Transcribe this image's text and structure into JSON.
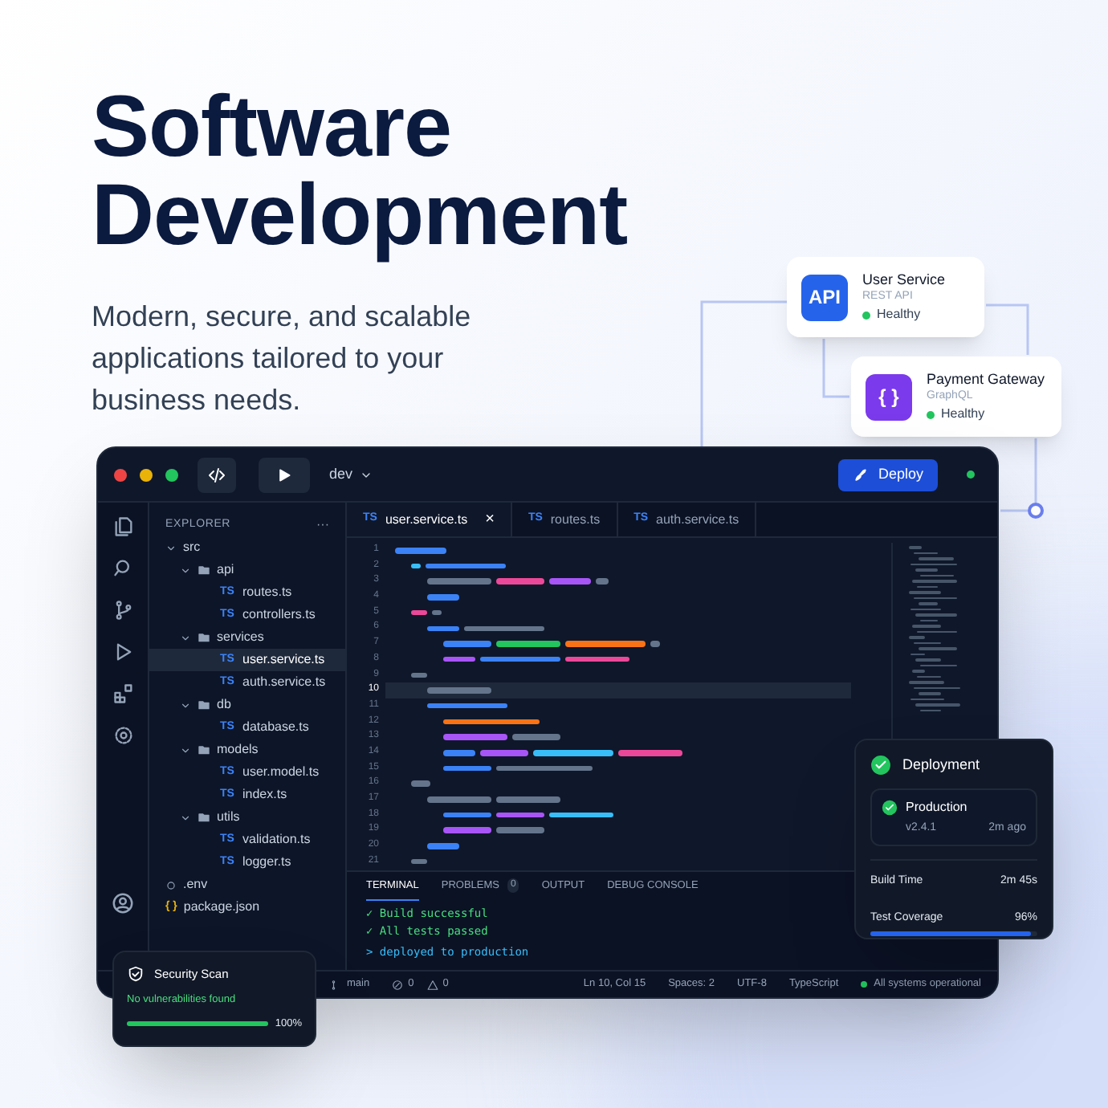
{
  "hero": {
    "title": "Software Development",
    "subtitle": "Modern, secure, and scalable applications tailored to your business needs."
  },
  "services": [
    {
      "icon_text": "API",
      "color": "#2563eb",
      "name": "User Service",
      "type": "REST API",
      "status": "Healthy"
    },
    {
      "icon_text": "{ }",
      "color": "#7c3aed",
      "name": "Payment Gateway",
      "type": "GraphQL",
      "status": "Healthy"
    }
  ],
  "editor": {
    "toolbar": {
      "branch": "dev",
      "deploy_label": "Deploy"
    },
    "explorer": {
      "title": "EXPLORER",
      "menu": "···",
      "tree": [
        {
          "kind": "folder",
          "name": "src",
          "expanded": true,
          "selected": false,
          "children": [
            {
              "kind": "folder",
              "name": "api",
              "expanded": true,
              "selected": false,
              "children": [
                {
                  "kind": "ts",
                  "badge": "TS",
                  "name": "routes.ts",
                  "selected": false
                },
                {
                  "kind": "ts",
                  "badge": "TS",
                  "name": "controllers.ts",
                  "selected": false
                }
              ]
            },
            {
              "kind": "folder",
              "name": "services",
              "expanded": true,
              "selected": false,
              "children": [
                {
                  "kind": "ts",
                  "badge": "TS",
                  "name": "user.service.ts",
                  "selected": true
                },
                {
                  "kind": "ts",
                  "badge": "TS",
                  "name": "auth.service.ts",
                  "selected": false
                }
              ]
            },
            {
              "kind": "folder",
              "name": "db",
              "expanded": true,
              "selected": false,
              "children": [
                {
                  "kind": "ts",
                  "badge": "TS",
                  "name": "database.ts",
                  "selected": false
                }
              ]
            },
            {
              "kind": "folder",
              "name": "models",
              "expanded": true,
              "selected": false,
              "children": [
                {
                  "kind": "ts",
                  "badge": "TS",
                  "name": "user.model.ts",
                  "selected": false
                },
                {
                  "kind": "ts",
                  "badge": "TS",
                  "name": "index.ts",
                  "selected": false
                }
              ]
            },
            {
              "kind": "folder",
              "name": "utils",
              "expanded": true,
              "selected": false,
              "children": [
                {
                  "kind": "ts",
                  "badge": "TS",
                  "name": "validation.ts",
                  "selected": false
                },
                {
                  "kind": "ts",
                  "badge": "TS",
                  "name": "logger.ts",
                  "selected": false
                }
              ]
            }
          ]
        },
        {
          "kind": "env",
          "name": ".env",
          "selected": false
        },
        {
          "kind": "json",
          "badge": "{ }",
          "name": "package.json",
          "selected": false
        }
      ]
    },
    "tabs": [
      {
        "badge": "TS",
        "label": "user.service.ts",
        "selected": true,
        "close": "×"
      },
      {
        "badge": "TS",
        "label": "routes.ts",
        "selected": false
      },
      {
        "badge": "TS",
        "label": "auth.service.ts",
        "selected": false
      }
    ],
    "line_numbers": [
      {
        "number": "1",
        "selected": false
      },
      {
        "number": "2",
        "selected": false
      },
      {
        "number": "3",
        "selected": false
      },
      {
        "number": "4",
        "selected": false
      },
      {
        "number": "5",
        "selected": false
      },
      {
        "number": "6",
        "selected": false
      },
      {
        "number": "7",
        "selected": false
      },
      {
        "number": "8",
        "selected": false
      },
      {
        "number": "9",
        "selected": false
      },
      {
        "number": "10",
        "selected": true
      },
      {
        "number": "11",
        "selected": false
      },
      {
        "number": "12",
        "selected": false
      },
      {
        "number": "13",
        "selected": false
      },
      {
        "number": "14",
        "selected": false
      },
      {
        "number": "15",
        "selected": false
      },
      {
        "number": "16",
        "selected": false
      },
      {
        "number": "17",
        "selected": false
      },
      {
        "number": "18",
        "selected": false
      },
      {
        "number": "19",
        "selected": false
      },
      {
        "number": "20",
        "selected": false
      },
      {
        "number": "21",
        "selected": false
      }
    ],
    "panel_tabs": [
      {
        "label": "TERMINAL",
        "selected": true
      },
      {
        "label": "PROBLEMS",
        "count": "0",
        "selected": false
      },
      {
        "label": "OUTPUT",
        "selected": false
      },
      {
        "label": "DEBUG CONSOLE",
        "selected": false
      }
    ],
    "terminal": [
      {
        "kind": "success",
        "prefix": "✓",
        "text": "Build successful"
      },
      {
        "kind": "success",
        "prefix": "✓",
        "text": "All tests passed"
      },
      {
        "kind": "command",
        "prefix": ">",
        "text": "deployed to production"
      }
    ],
    "status_bar": {
      "branch": "main",
      "errors": "0",
      "warnings": "0",
      "position": "Ln 10, Col 15",
      "spaces": "Spaces: 2",
      "encoding": "UTF-8",
      "language": "TypeScript",
      "health": "All systems operational"
    }
  },
  "deployment": {
    "title": "Deployment",
    "environment": "Production",
    "version": "v2.4.1",
    "time": "2m ago",
    "build_time_label": "Build Time",
    "build_time": "2m 45s",
    "coverage_label": "Test Coverage",
    "coverage": "96%",
    "level": 0.96
  },
  "security": {
    "title": "Security Scan",
    "message": "No vulnerabilities found",
    "percent": "100%",
    "level": 1.0
  }
}
